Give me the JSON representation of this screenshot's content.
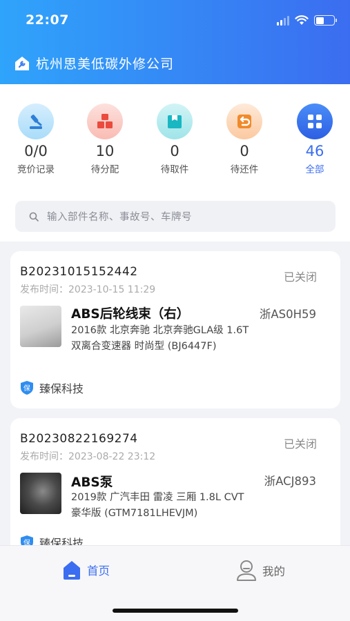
{
  "status_bar": {
    "time": "22:07"
  },
  "header": {
    "company_name": "杭州思美低碳外修公司"
  },
  "stats": [
    {
      "value": "0/0",
      "label": "竞价记录",
      "icon": "gavel-icon",
      "color": "#9fd3f7"
    },
    {
      "value": "10",
      "label": "待分配",
      "icon": "boxes-icon",
      "color": "#f6a59d"
    },
    {
      "value": "0",
      "label": "待取件",
      "icon": "package-icon",
      "color": "#7fd7dd"
    },
    {
      "value": "0",
      "label": "待还件",
      "icon": "return-icon",
      "color": "#f8b27c"
    },
    {
      "value": "46",
      "label": "全部",
      "icon": "grid-icon",
      "color": "#3b6df0"
    }
  ],
  "search": {
    "placeholder": "输入部件名称、事故号、车牌号"
  },
  "orders": [
    {
      "id": "B20231015152442",
      "status": "已关闭",
      "time_label": "发布时间：",
      "time": "2023-10-15 11:29",
      "part_name": "ABS后轮线束（右）",
      "plate": "浙AS0H59",
      "car_desc": "2016款 北京奔驰 北京奔驰GLA级 1.6T 双离合变速器 时尚型 (BJ6447F)",
      "vendor": "臻保科技"
    },
    {
      "id": "B20230822169274",
      "status": "已关闭",
      "time_label": "发布时间：",
      "time": "2023-08-22 23:12",
      "part_name": "ABS泵",
      "plate": "浙ACJ893",
      "car_desc": "2019款 广汽丰田 雷凌 三厢 1.8L CVT 豪华版 (GTM7181LHEVJM)",
      "vendor": "臻保科技"
    }
  ],
  "tabbar": {
    "home": "首页",
    "mine": "我的"
  },
  "colors": {
    "accent": "#3b6df0",
    "header_start": "#2fa4fb"
  }
}
